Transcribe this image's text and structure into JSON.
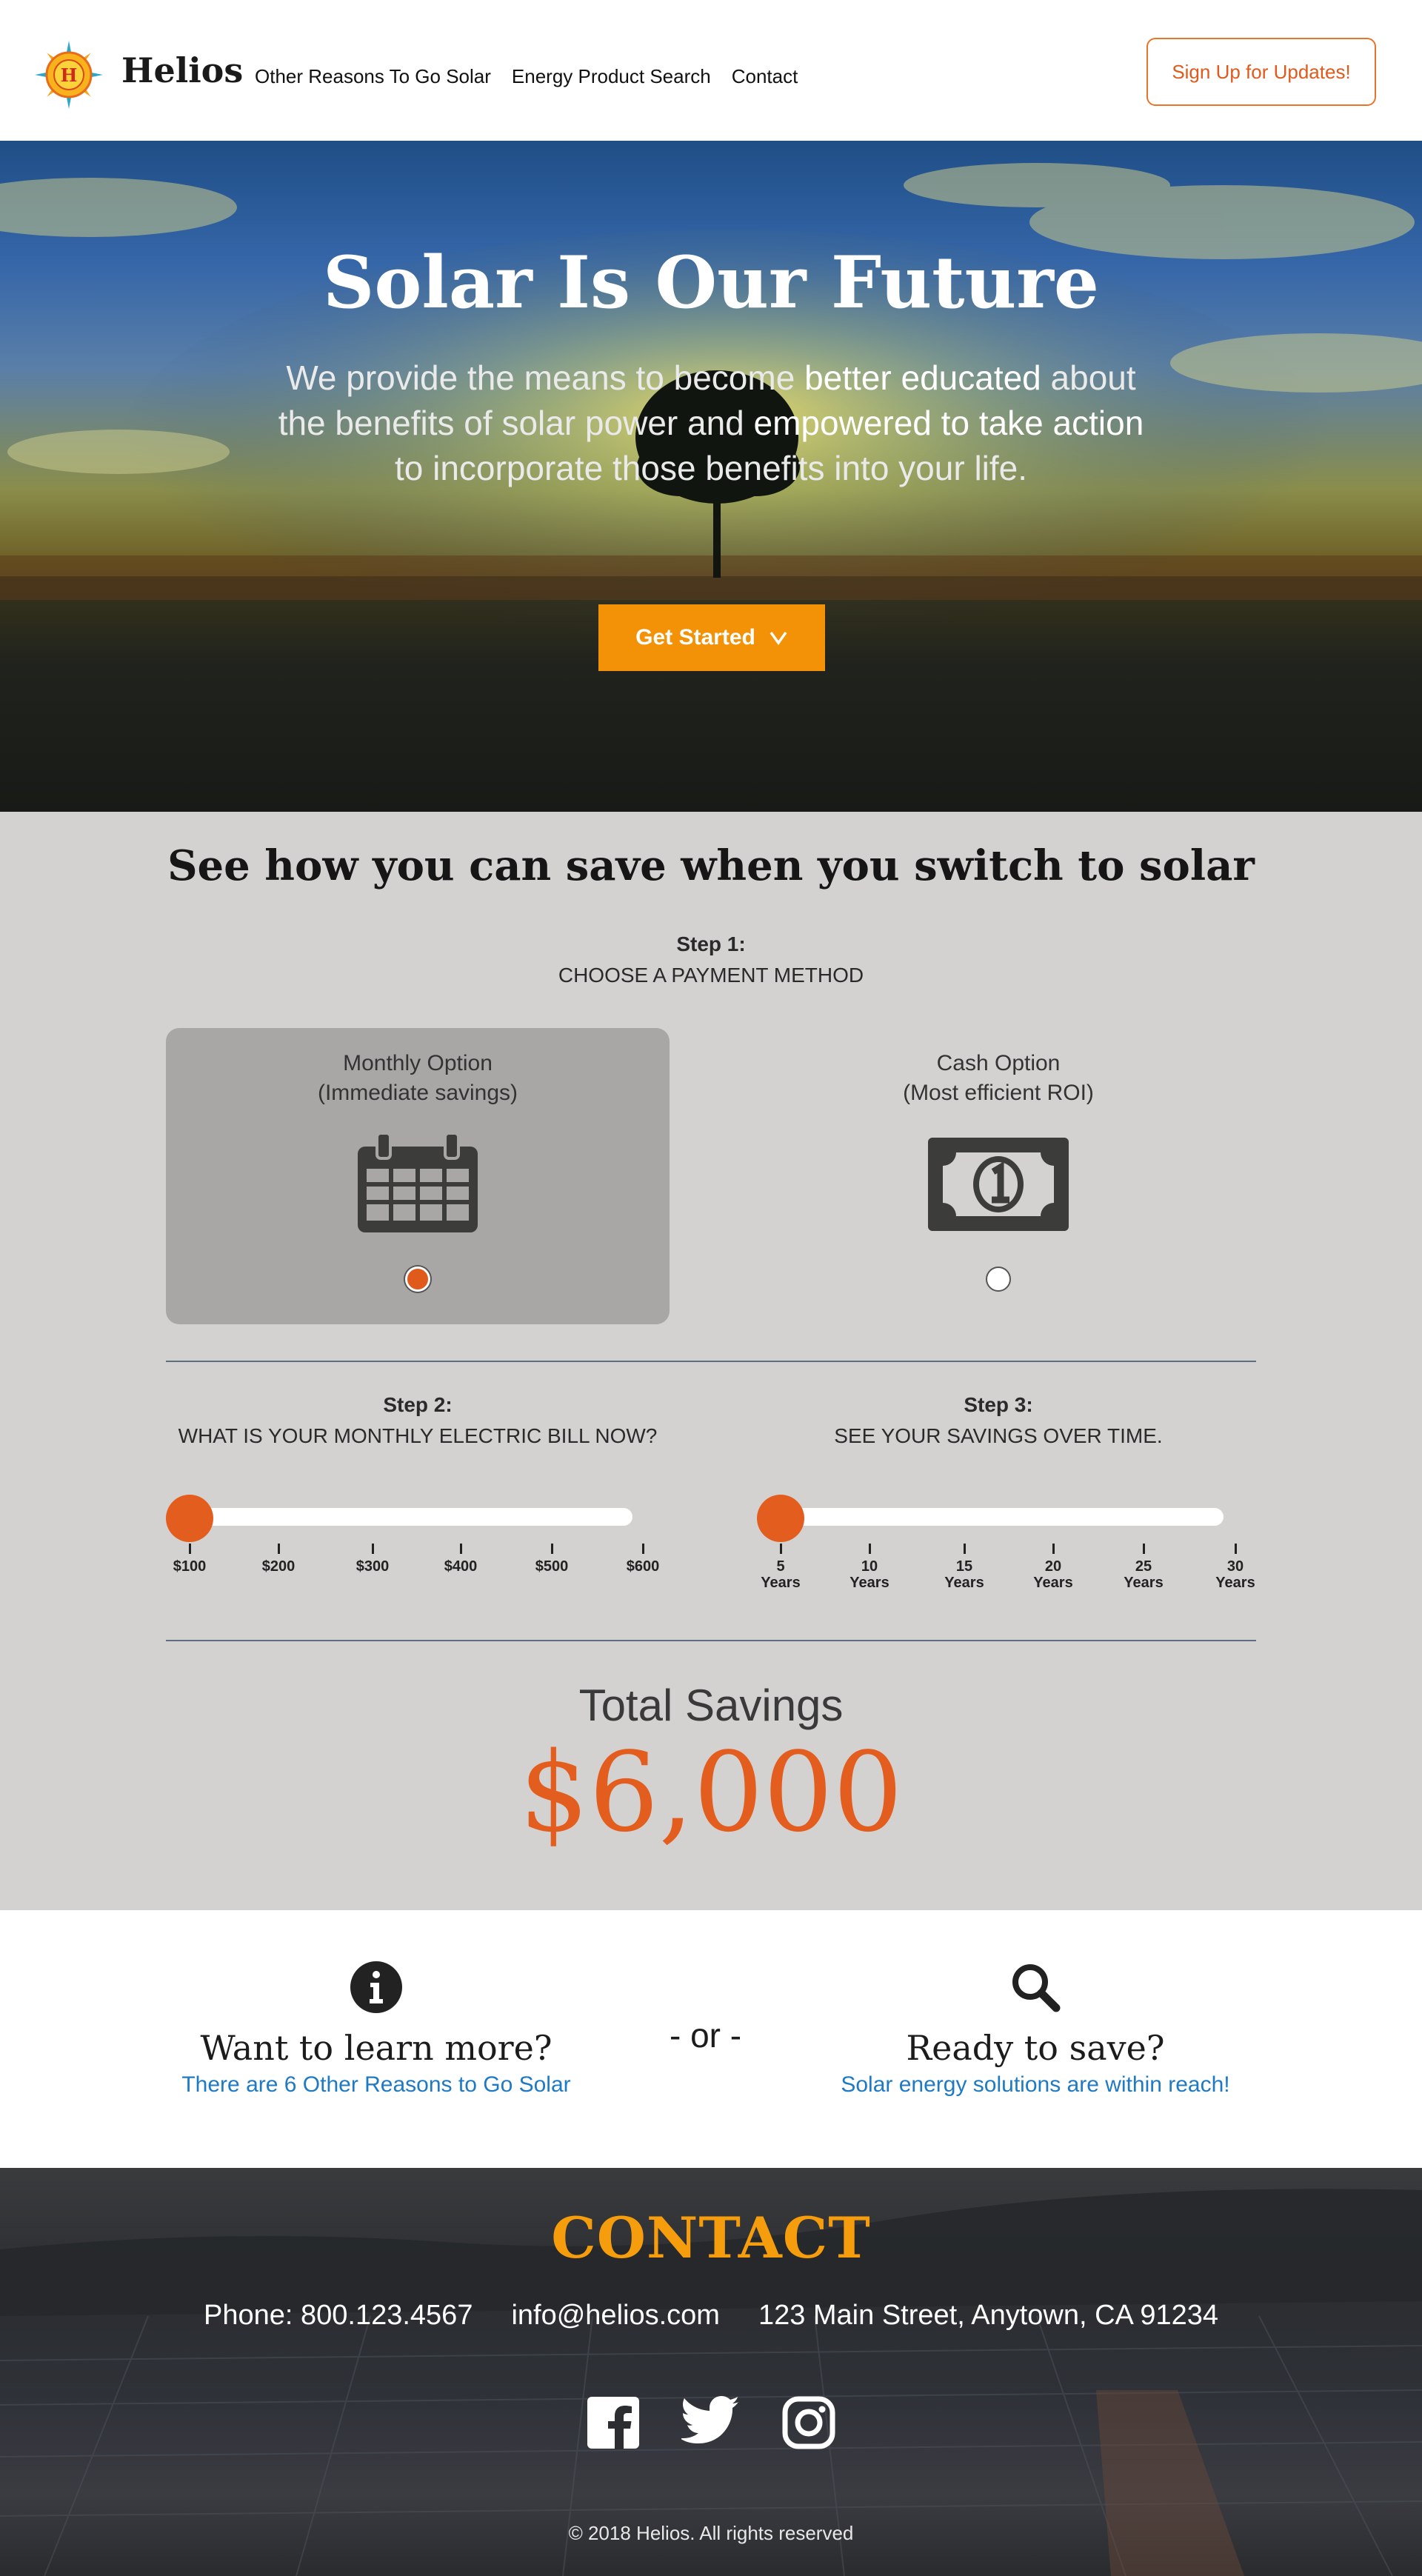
{
  "brand": {
    "name": "Helios",
    "logo_letter": "H"
  },
  "nav": {
    "items": [
      "Other Reasons To Go Solar",
      "Energy Product Search",
      "Contact"
    ],
    "signup_label": "Sign Up for Updates!"
  },
  "hero": {
    "title": "Solar Is Our Future",
    "subtitle_parts": [
      "We provide the means to become ",
      "better educated",
      " about the benefits of solar power and ",
      "empowered to take action",
      " to incorporate those benefits into your life."
    ],
    "cta_label": "Get Started"
  },
  "calculator": {
    "title": "See how you can save when you switch to solar",
    "step1": {
      "label": "Step 1:",
      "heading": "CHOOSE A PAYMENT METHOD"
    },
    "options": [
      {
        "line1": "Monthly Option",
        "line2": "(Immediate savings)",
        "icon": "calendar-icon",
        "selected": true
      },
      {
        "line1": "Cash Option",
        "line2": "(Most efficient ROI)",
        "icon": "money-bill-icon",
        "selected": false
      }
    ],
    "step2": {
      "label": "Step 2:",
      "heading": "WHAT IS YOUR MONTHLY ELECTRIC BILL NOW?",
      "value": 100,
      "ticks": [
        "$100",
        "$200",
        "$300",
        "$400",
        "$500",
        "$600"
      ]
    },
    "step3": {
      "label": "Step 3:",
      "heading": "SEE YOUR SAVINGS OVER TIME.",
      "value": 5,
      "ticks": [
        [
          "5",
          "Years"
        ],
        [
          "10",
          "Years"
        ],
        [
          "15",
          "Years"
        ],
        [
          "20",
          "Years"
        ],
        [
          "25",
          "Years"
        ],
        [
          "30",
          "Years"
        ]
      ]
    },
    "total_label": "Total Savings",
    "total_value": "$6,000"
  },
  "info": {
    "left": {
      "icon": "info-icon",
      "title": "Want to learn more?",
      "link": "There are 6 Other Reasons to Go Solar"
    },
    "separator": "- or -",
    "right": {
      "icon": "search-icon",
      "title": "Ready to save?",
      "link": "Solar energy solutions are within reach!"
    }
  },
  "footer": {
    "title": "CONTACT",
    "phone": "Phone: 800.123.4567",
    "email": "info@helios.com",
    "address": "123 Main Street, Anytown, CA 91234",
    "social": [
      "facebook-icon",
      "twitter-icon",
      "instagram-icon"
    ],
    "copyright": "© 2018 Helios. All rights reserved"
  },
  "colors": {
    "accent": "#e35e1e",
    "cta": "#f39206",
    "link": "#1f7ac5",
    "contact": "#f59d0c",
    "panel": "#d3d2d1"
  }
}
